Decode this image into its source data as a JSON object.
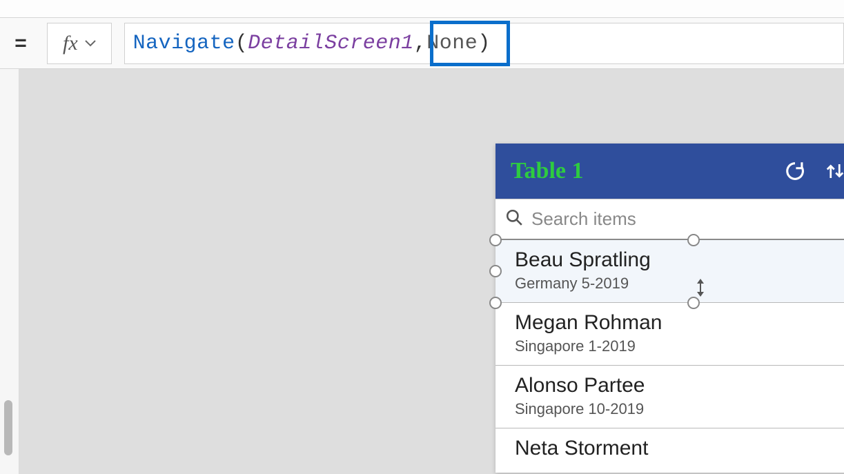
{
  "formula": {
    "equals": "=",
    "fx_label": "fx",
    "tokens": {
      "navigate": "Navigate",
      "open": "(",
      "arg1": "DetailScreen1",
      "comma": ",",
      "none": " None",
      "close": ")"
    }
  },
  "gallery": {
    "title": "Table 1",
    "search_placeholder": "Search items",
    "search_value": "",
    "rows": [
      {
        "name": "Beau Spratling",
        "sub": "Germany 5-2019"
      },
      {
        "name": "Megan Rohman",
        "sub": "Singapore 1-2019"
      },
      {
        "name": "Alonso Partee",
        "sub": "Singapore 10-2019"
      },
      {
        "name": "Neta Storment",
        "sub": ""
      }
    ]
  },
  "icons": {
    "refresh": "refresh-icon",
    "sort": "sort-icon",
    "search": "search-icon",
    "dropdown": "chevron-down-icon"
  }
}
